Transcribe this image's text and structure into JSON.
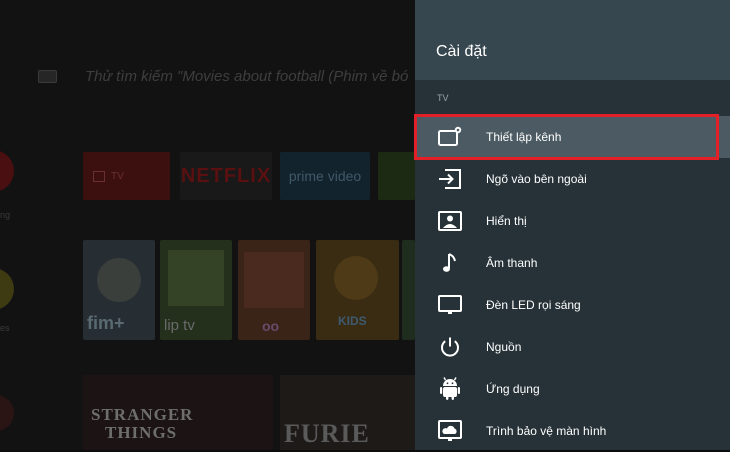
{
  "background": {
    "search_placeholder": "Thử tìm kiếm \"Movies about football (Phim về bó",
    "side_labels": [
      "ng",
      "es"
    ],
    "apps": {
      "tv_label": "TV",
      "netflix": "NETFLIX",
      "prime": "prime video"
    },
    "posters": [
      "fim+",
      "lip tv",
      "oo",
      "",
      "",
      "KIDS"
    ],
    "titles": {
      "stranger_line1": "STRANGER",
      "stranger_line2": "THINGS",
      "furie": "FURIE"
    }
  },
  "settings": {
    "title": "Cài đặt",
    "section": "TV",
    "items": [
      {
        "label": "Thiết lập kênh",
        "icon": "channel-setup-icon"
      },
      {
        "label": "Ngõ vào bên ngoài",
        "icon": "external-input-icon"
      },
      {
        "label": "Hiển thị",
        "icon": "display-icon"
      },
      {
        "label": "Âm thanh",
        "icon": "music-note-icon"
      },
      {
        "label": "Đèn LED rọi sáng",
        "icon": "led-illumination-icon"
      },
      {
        "label": "Nguồn",
        "icon": "power-icon"
      },
      {
        "label": "Ứng dụng",
        "icon": "android-icon"
      },
      {
        "label": "Trình bảo vệ màn hình",
        "icon": "screensaver-icon"
      }
    ],
    "selected_index": 0
  },
  "colors": {
    "panel_bg": "#263238",
    "header_bg": "#37474f",
    "selected_bg": "#4c5b63",
    "highlight_border": "#e32027"
  }
}
